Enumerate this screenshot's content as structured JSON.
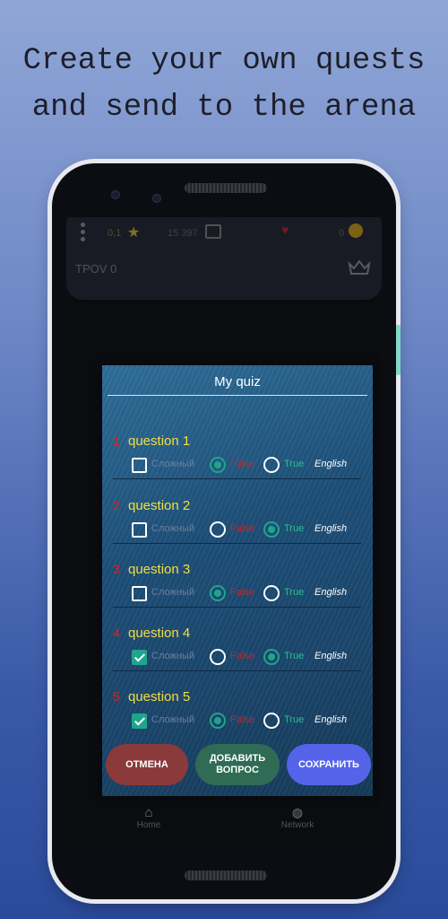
{
  "headline": {
    "line1": "Create your own quests",
    "line2": "and send to the arena"
  },
  "app": {
    "top_bar": {
      "rating": "0,1",
      "points": "15 397",
      "coins": "0",
      "player_name": "TPOV 0"
    },
    "nav": {
      "home_label": "Home",
      "network_label": "Network"
    }
  },
  "dialog": {
    "title": "My quiz",
    "difficulty_label": "Сложный",
    "false_label": "False",
    "true_label": "True",
    "language_label": "English",
    "questions": [
      {
        "number": "1",
        "text": "question 1",
        "hard": false,
        "answer": "False"
      },
      {
        "number": "2",
        "text": "question 2",
        "hard": false,
        "answer": "True"
      },
      {
        "number": "3",
        "text": "question 3",
        "hard": false,
        "answer": "False"
      },
      {
        "number": "4",
        "text": "question 4",
        "hard": true,
        "answer": "True"
      },
      {
        "number": "5",
        "text": "question 5",
        "hard": true,
        "answer": "False"
      }
    ],
    "buttons": {
      "cancel": "ОТМЕНА",
      "add_line1": "ДОБАВИТЬ",
      "add_line2": "ВОПРОС",
      "save": "СОХРАНИТЬ"
    }
  },
  "colors": {
    "cancel_button": "#8a3a3a",
    "add_button": "#2f6b55",
    "save_button": "#5563e8",
    "accent": "#1fa58c"
  }
}
